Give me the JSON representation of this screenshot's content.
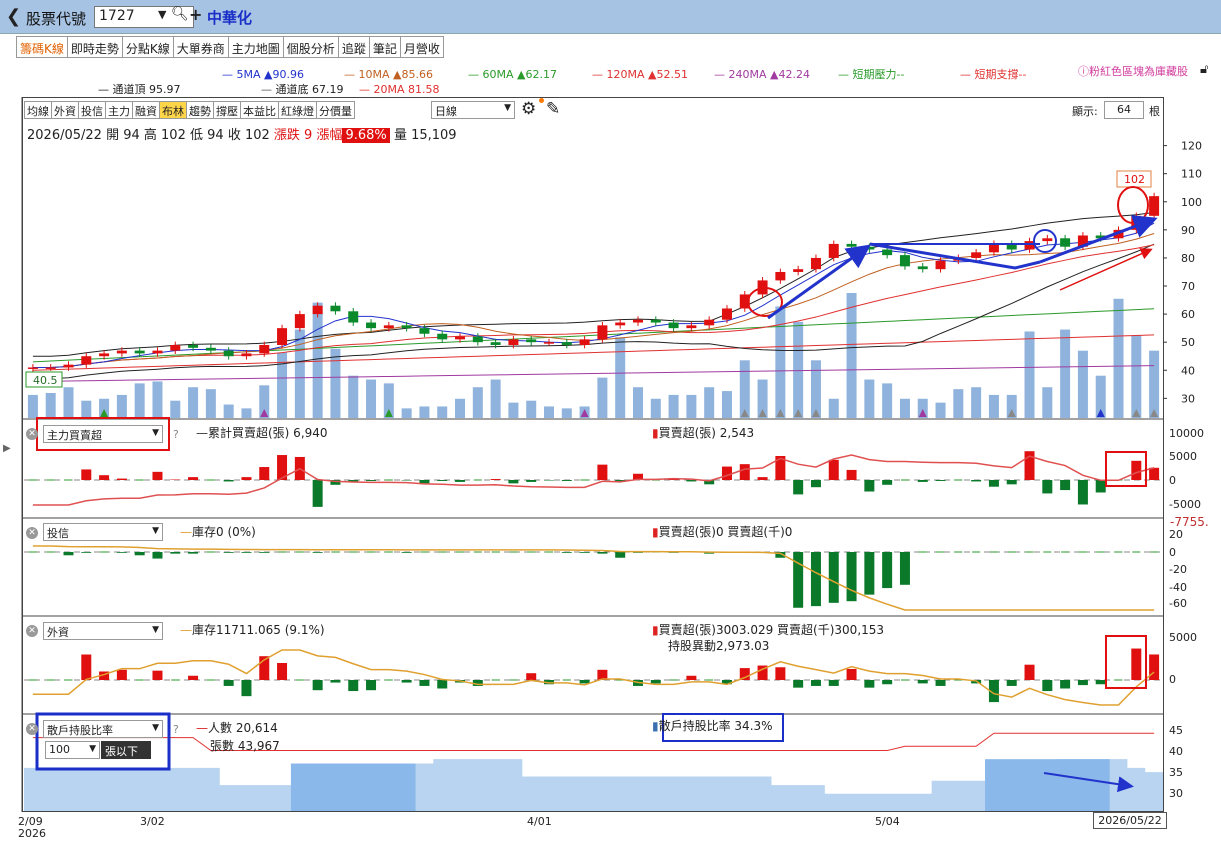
{
  "header": {
    "back_icon": "chevron-left-icon",
    "label": "股票代號",
    "code": "1727",
    "stock_name": "中華化"
  },
  "tabs": [
    "籌碼K線",
    "即時走勢",
    "分點K線",
    "大單券商",
    "主力地圖",
    "個股分析",
    "追蹤",
    "筆記",
    "月營收"
  ],
  "ma_legend": [
    {
      "label": "5MA ▲90.96",
      "color": "#2233cc"
    },
    {
      "label": "10MA ▲85.66",
      "color": "#c06020"
    },
    {
      "label": "60MA ▲62.17",
      "color": "#2a9a2a"
    },
    {
      "label": "120MA ▲52.51",
      "color": "#e03030"
    },
    {
      "label": "240MA ▲42.24",
      "color": "#a03aa0"
    },
    {
      "label": "短期壓力--",
      "color": "#2a9a2a"
    },
    {
      "label": "短期支撐--",
      "color": "#e03030"
    }
  ],
  "ma_legend2": [
    {
      "label": "通道頂 95.97",
      "color": "#222"
    },
    {
      "label": "通道底 67.19",
      "color": "#555"
    },
    {
      "label": "20MA 81.58",
      "color": "#e03030"
    }
  ],
  "pink_link": "ⓘ粉紅色區塊為庫藏股",
  "toolbar": {
    "buttons": [
      "均線",
      "外資",
      "投信",
      "主力",
      "融資",
      "布林",
      "趨勢",
      "撐壓",
      "本益比",
      "紅綠燈",
      "分價量"
    ],
    "active": "布林",
    "period": "日線",
    "show_label": "顯示:",
    "show_value": "64",
    "show_unit": "根"
  },
  "info": {
    "date": "2026/05/22",
    "open": "開 94",
    "high": "高 102",
    "low": "低 94",
    "close": "收 102",
    "change": "漲跌 9",
    "pct_label": "漲幅",
    "pct": "9.68%",
    "volume": "量 15,109"
  },
  "price_axis": [
    "120",
    "110",
    "100",
    "90",
    "80",
    "70",
    "60",
    "50",
    "40",
    "30"
  ],
  "last_price_tag": "102",
  "left_price_tag": "40.5",
  "panels": {
    "main_force": {
      "select": "主力買賣超",
      "cum_label": "累計買賣超(張) 6,940",
      "net_label": "買賣超(張) 2,543",
      "axis": [
        "10000",
        "5000",
        "0",
        "-5000"
      ],
      "extra": "-7755."
    },
    "trust": {
      "select": "投信",
      "inv_label": "庫存0 (0%)",
      "net_label": "買賣超(張)0 買賣超(千)0",
      "axis": [
        "20",
        "0",
        "-20",
        "-40",
        "-60"
      ]
    },
    "foreign": {
      "select": "外資",
      "inv_label": "庫存11711.065 (9.1%)",
      "net_label": "買賣超(張)3003.029 買賣超(千)300,153",
      "change_label": "持股異動2,973.03",
      "axis": [
        "5000",
        "0"
      ]
    },
    "retail": {
      "select": "散戶持股比率",
      "people": "人數 20,614",
      "shares": "張數 43,967",
      "ratio": "散戶持股比率 34.3%",
      "threshold": "100",
      "threshold_unit": "張以下",
      "axis": [
        "45",
        "40",
        "35",
        "30"
      ]
    }
  },
  "x_axis": {
    "labels": [
      {
        "text": "2/09",
        "sub": "2026"
      },
      {
        "text": "3/02",
        "sub": ""
      },
      {
        "text": "4/01",
        "sub": ""
      },
      {
        "text": "5/04",
        "sub": ""
      }
    ],
    "cursor_date": "2026/05/22"
  },
  "chart_data": {
    "type": "candlestick",
    "bars": 64,
    "closes": [
      41,
      41,
      42,
      45,
      46,
      47,
      46,
      47,
      49,
      48,
      47,
      45,
      46,
      49,
      55,
      60,
      63,
      61,
      57,
      55,
      56,
      55,
      53,
      51,
      52,
      50,
      49,
      51,
      50,
      50,
      49,
      51,
      56,
      57,
      58,
      57,
      55,
      56,
      58,
      62,
      67,
      72,
      75,
      76,
      80,
      85,
      84,
      83,
      81,
      77,
      76,
      79,
      80,
      82,
      85,
      83,
      86,
      87,
      84,
      88,
      87,
      90,
      95,
      102
    ],
    "volume": [
      12,
      13,
      16,
      9,
      10,
      12,
      18,
      19,
      9,
      16,
      15,
      7,
      5,
      17,
      34,
      46,
      60,
      36,
      22,
      20,
      18,
      5,
      6,
      6,
      10,
      16,
      20,
      8,
      9,
      6,
      5,
      6,
      21,
      42,
      16,
      10,
      12,
      12,
      16,
      14,
      30,
      20,
      58,
      50,
      30,
      10,
      65,
      20,
      18,
      10,
      10,
      8,
      15,
      16,
      12,
      12,
      45,
      16,
      46,
      35,
      22,
      62,
      43,
      35
    ],
    "main_force": [
      0,
      0,
      0,
      2200,
      1000,
      300,
      0,
      1700,
      100,
      600,
      0,
      -300,
      600,
      2700,
      5200,
      4800,
      -5600,
      -1000,
      -300,
      -200,
      0,
      -100,
      -700,
      -200,
      -400,
      0,
      200,
      -700,
      -400,
      -100,
      -200,
      0,
      3200,
      -300,
      1300,
      0,
      400,
      -300,
      -900,
      2800,
      3300,
      600,
      5000,
      -3000,
      -1500,
      4200,
      2100,
      -2400,
      -1000,
      0,
      -400,
      -200,
      0,
      -300,
      -1400,
      -900,
      6000,
      -2800,
      -2100,
      -5100,
      -2600,
      0,
      4000,
      2543
    ],
    "trust": [
      0,
      0,
      -4,
      -1,
      0,
      -1,
      -4,
      -8,
      -2,
      -2,
      0,
      -1,
      -1,
      -1,
      0,
      0,
      -1,
      0,
      0,
      0,
      0,
      -1,
      0,
      0,
      0,
      0,
      0,
      0,
      0,
      0,
      -1,
      -1,
      -2,
      -7,
      -1,
      0,
      -1,
      0,
      -2,
      -1,
      0,
      -1,
      -7,
      -68,
      -66,
      -62,
      -60,
      -52,
      -44,
      -40,
      0,
      0,
      0,
      0,
      0,
      0,
      0,
      0,
      0,
      0,
      0,
      0,
      0,
      0
    ],
    "foreign": [
      0,
      0,
      0,
      3000,
      1000,
      1200,
      0,
      1100,
      0,
      500,
      0,
      -700,
      -1900,
      2800,
      2000,
      0,
      -1200,
      -300,
      -1300,
      -1200,
      0,
      -300,
      -700,
      -1000,
      -300,
      -700,
      0,
      0,
      800,
      -500,
      0,
      -400,
      1200,
      0,
      -700,
      -400,
      0,
      500,
      0,
      -500,
      1400,
      1700,
      1500,
      -900,
      -700,
      -700,
      1300,
      -900,
      -500,
      0,
      -400,
      -700,
      0,
      -400,
      -2600,
      -700,
      1800,
      -1300,
      -1000,
      -600,
      -500,
      0,
      3700,
      3003
    ],
    "retail_ratio": [
      35,
      35,
      35,
      35,
      35,
      35,
      35,
      35,
      35,
      35,
      35,
      31,
      31,
      31,
      31,
      36,
      36,
      36,
      36,
      36,
      36,
      36,
      36,
      37,
      37,
      37,
      37,
      37,
      33,
      33,
      33,
      33,
      33,
      33,
      33,
      33,
      33,
      33,
      33,
      33,
      33,
      33,
      31,
      31,
      31,
      29,
      29,
      29,
      29,
      29,
      29,
      32,
      32,
      32,
      34,
      35,
      35,
      35,
      37,
      37,
      37,
      37,
      35,
      34
    ]
  }
}
